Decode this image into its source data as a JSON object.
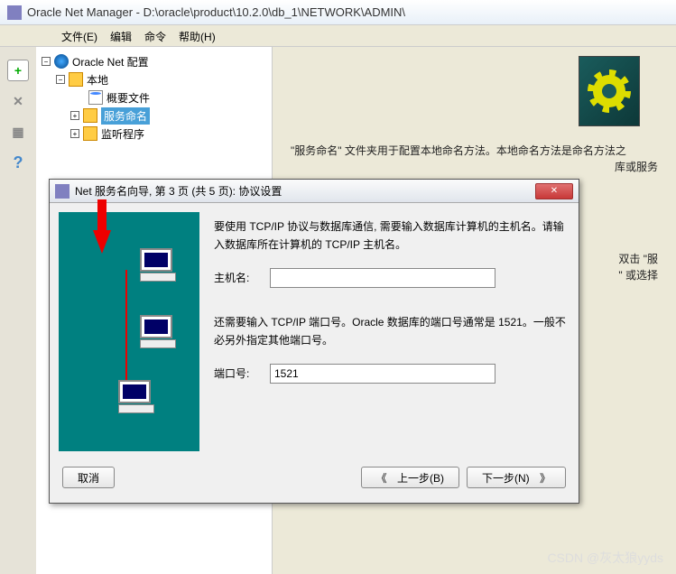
{
  "titlebar": {
    "text": "Oracle Net Manager - D:\\oracle\\product\\10.2.0\\db_1\\NETWORK\\ADMIN\\"
  },
  "menu": {
    "file": "文件(E)",
    "edit": "编辑",
    "cmd": "命令",
    "help": "帮助(H)"
  },
  "tree": {
    "root": "Oracle Net 配置",
    "local": "本地",
    "profile": "概要文件",
    "service": "服务命名",
    "listener": "监听程序"
  },
  "desc": {
    "line1": "\"服务命名\" 文件夹用于配置本地命名方法。本地命名方法是命名方法之",
    "line2a": "库或服务",
    "hint1": "双击 \"服",
    "hint2": "\" 或选择"
  },
  "wizard": {
    "title": "Net 服务名向导, 第 3 页 (共 5 页): 协议设置",
    "para1": "要使用 TCP/IP 协议与数据库通信, 需要输入数据库计算机的主机名。请输入数据库所在计算机的 TCP/IP 主机名。",
    "host_label": "主机名:",
    "host_value": "",
    "para2": "还需要输入 TCP/IP 端口号。Oracle 数据库的端口号通常是 1521。一般不必另外指定其他端口号。",
    "port_label": "端口号:",
    "port_value": "1521",
    "cancel": "取消",
    "back": "上一步(B)",
    "next": "下一步(N)",
    "left": "《",
    "right": "》"
  },
  "watermark": "CSDN @灰太狼yyds"
}
